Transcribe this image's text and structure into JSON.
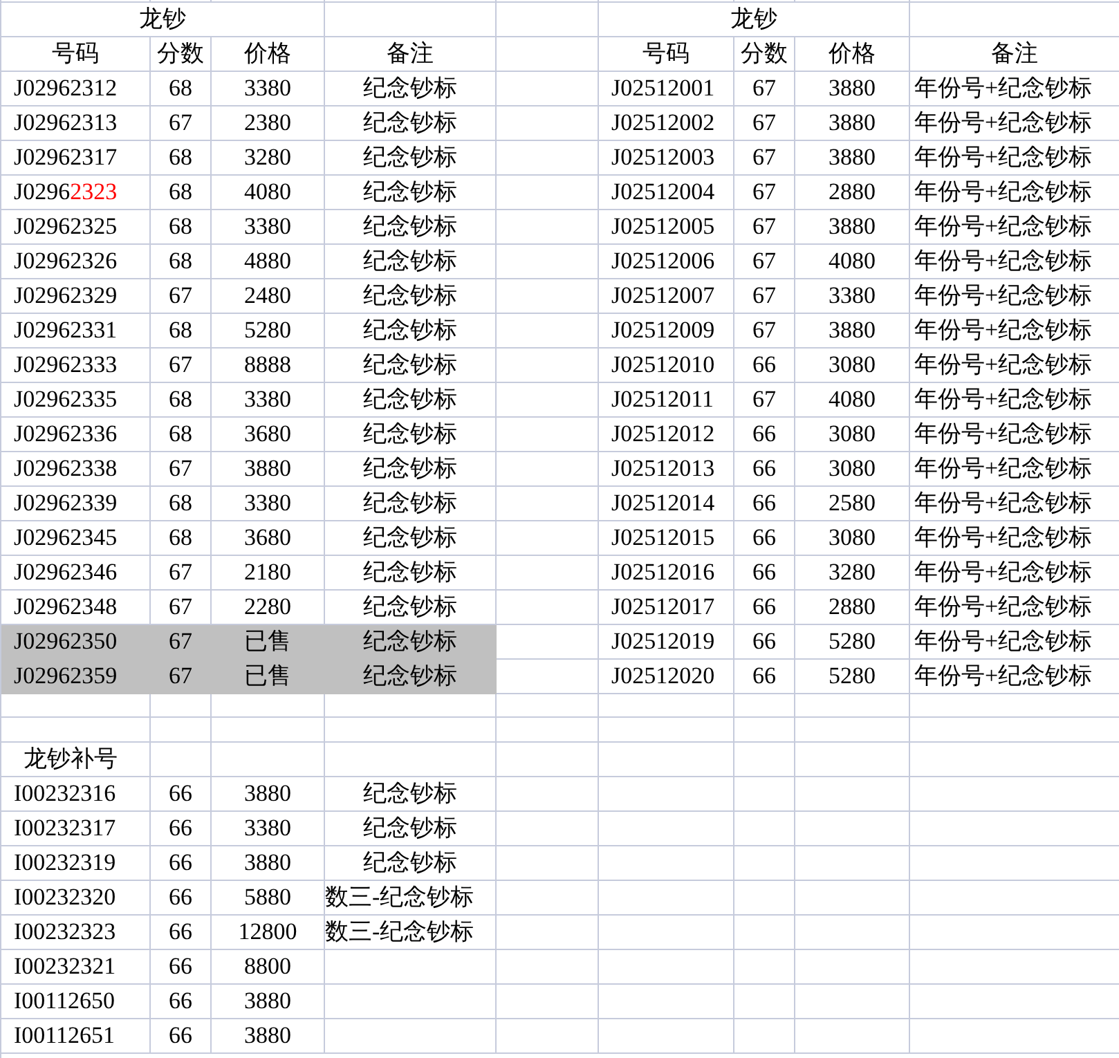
{
  "left_table": {
    "title": "龙钞",
    "columns": [
      "号码",
      "分数",
      "价格",
      "备注"
    ],
    "rows": [
      {
        "code": "J02962312",
        "score": "68",
        "price": "3380",
        "note": "纪念钞标",
        "sold": false
      },
      {
        "code": "J02962313",
        "score": "67",
        "price": "2380",
        "note": "纪念钞标",
        "sold": false
      },
      {
        "code": "J02962317",
        "score": "68",
        "price": "3280",
        "note": "纪念钞标",
        "sold": false
      },
      {
        "code_segments": [
          {
            "text": "J0296",
            "red": false
          },
          {
            "text": "2323",
            "red": true
          }
        ],
        "score": "68",
        "price": "4080",
        "note": "纪念钞标",
        "sold": false
      },
      {
        "code": "J02962325",
        "score": "68",
        "price": "3380",
        "note": "纪念钞标",
        "sold": false
      },
      {
        "code": "J02962326",
        "score": "68",
        "price": "4880",
        "note": "纪念钞标",
        "sold": false
      },
      {
        "code": "J02962329",
        "score": "67",
        "price": "2480",
        "note": "纪念钞标",
        "sold": false
      },
      {
        "code": "J02962331",
        "score": "68",
        "price": "5280",
        "note": "纪念钞标",
        "sold": false
      },
      {
        "code": "J02962333",
        "score": "67",
        "price": "8888",
        "note": "纪念钞标",
        "sold": false
      },
      {
        "code": "J02962335",
        "score": "68",
        "price": "3380",
        "note": "纪念钞标",
        "sold": false
      },
      {
        "code": "J02962336",
        "score": "68",
        "price": "3680",
        "note": "纪念钞标",
        "sold": false
      },
      {
        "code": "J02962338",
        "score": "67",
        "price": "3880",
        "note": "纪念钞标",
        "sold": false
      },
      {
        "code": "J02962339",
        "score": "68",
        "price": "3380",
        "note": "纪念钞标",
        "sold": false
      },
      {
        "code": "J02962345",
        "score": "68",
        "price": "3680",
        "note": "纪念钞标",
        "sold": false
      },
      {
        "code": "J02962346",
        "score": "67",
        "price": "2180",
        "note": "纪念钞标",
        "sold": false
      },
      {
        "code": "J02962348",
        "score": "67",
        "price": "2280",
        "note": "纪念钞标",
        "sold": false
      },
      {
        "code": "J02962350",
        "score": "67",
        "price": "已售",
        "note": "纪念钞标",
        "sold": true
      },
      {
        "code": "J02962359",
        "score": "67",
        "price": "已售",
        "note": "纪念钞标",
        "sold": true
      }
    ]
  },
  "right_table": {
    "title": "龙钞",
    "columns": [
      "号码",
      "分数",
      "价格",
      "备注"
    ],
    "rows": [
      {
        "code": "J02512001",
        "score": "67",
        "price": "3880",
        "note": "年份号+纪念钞标"
      },
      {
        "code": "J02512002",
        "score": "67",
        "price": "3880",
        "note": "年份号+纪念钞标"
      },
      {
        "code": "J02512003",
        "score": "67",
        "price": "3880",
        "note": "年份号+纪念钞标"
      },
      {
        "code": "J02512004",
        "score": "67",
        "price": "2880",
        "note": "年份号+纪念钞标"
      },
      {
        "code": "J02512005",
        "score": "67",
        "price": "3880",
        "note": "年份号+纪念钞标"
      },
      {
        "code": "J02512006",
        "score": "67",
        "price": "4080",
        "note": "年份号+纪念钞标"
      },
      {
        "code": "J02512007",
        "score": "67",
        "price": "3380",
        "note": "年份号+纪念钞标"
      },
      {
        "code": "J02512009",
        "score": "67",
        "price": "3880",
        "note": "年份号+纪念钞标"
      },
      {
        "code": "J02512010",
        "score": "66",
        "price": "3080",
        "note": "年份号+纪念钞标"
      },
      {
        "code": "J02512011",
        "score": "67",
        "price": "4080",
        "note": "年份号+纪念钞标"
      },
      {
        "code": "J02512012",
        "score": "66",
        "price": "3080",
        "note": "年份号+纪念钞标"
      },
      {
        "code": "J02512013",
        "score": "66",
        "price": "3080",
        "note": "年份号+纪念钞标"
      },
      {
        "code": "J02512014",
        "score": "66",
        "price": "2580",
        "note": "年份号+纪念钞标"
      },
      {
        "code": "J02512015",
        "score": "66",
        "price": "3080",
        "note": "年份号+纪念钞标"
      },
      {
        "code": "J02512016",
        "score": "66",
        "price": "3280",
        "note": "年份号+纪念钞标"
      },
      {
        "code": "J02512017",
        "score": "66",
        "price": "2880",
        "note": "年份号+纪念钞标"
      },
      {
        "code": "J02512019",
        "score": "66",
        "price": "5280",
        "note": "年份号+纪念钞标"
      },
      {
        "code": "J02512020",
        "score": "66",
        "price": "5280",
        "note": "年份号+纪念钞标"
      }
    ]
  },
  "supplement": {
    "title": "龙钞补号",
    "rows": [
      {
        "code": "I00232316",
        "score": "66",
        "price": "3880",
        "note": "纪念钞标"
      },
      {
        "code": "I00232317",
        "score": "66",
        "price": "3380",
        "note": "纪念钞标"
      },
      {
        "code": "I00232319",
        "score": "66",
        "price": "3880",
        "note": "纪念钞标"
      },
      {
        "code": "I00232320",
        "score": "66",
        "price": "5880",
        "note": "数三-纪念钞标"
      },
      {
        "code": "I00232323",
        "score": "66",
        "price": "12800",
        "note": "数三-纪念钞标"
      },
      {
        "code": "I00232321",
        "score": "66",
        "price": "8800"
      },
      {
        "code": "I00112650",
        "score": "66",
        "price": "3880"
      },
      {
        "code": "I00112651",
        "score": "66",
        "price": "3880"
      }
    ]
  }
}
